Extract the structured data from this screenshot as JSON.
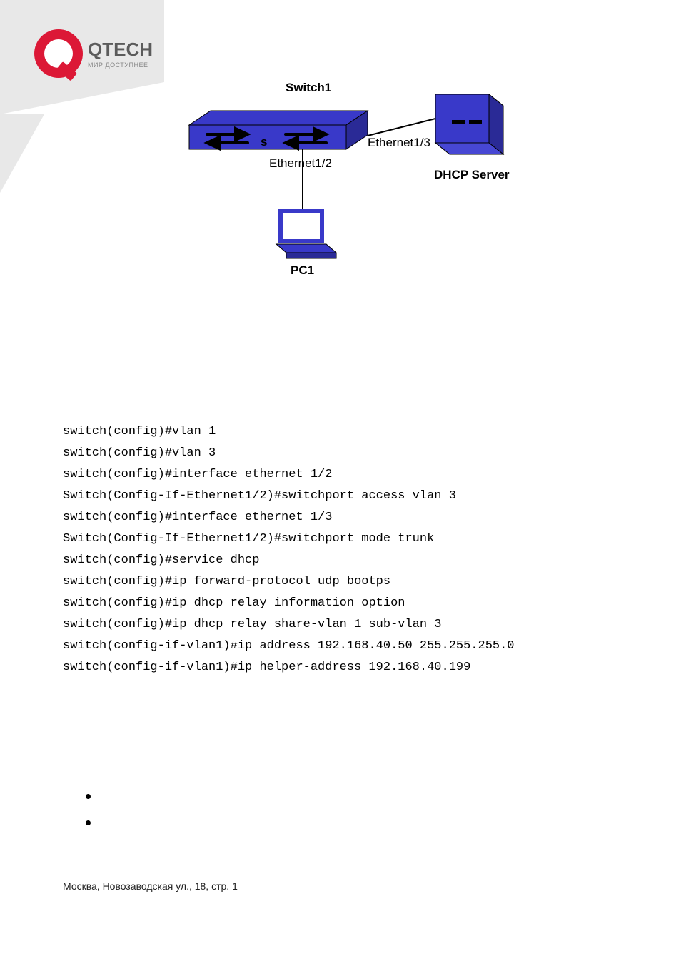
{
  "logo": {
    "brand": "QTECH",
    "tagline": "МИР ДОСТУПНЕЕ"
  },
  "diagram": {
    "switch_label": "Switch1",
    "port_left": "Ethernet1/2",
    "port_right": "Ethernet1/3",
    "pc_label": "PC1",
    "server_label": "DHCP Server",
    "switch_letter": "s"
  },
  "code": {
    "line1": "switch(config)#vlan 1",
    "line2": "switch(config)#vlan 3",
    "line3": "switch(config)#interface ethernet 1/2",
    "line4": "Switch(Config-If-Ethernet1/2)#switchport access vlan 3",
    "line5": "switch(config)#interface ethernet 1/3",
    "line6": "Switch(Config-If-Ethernet1/2)#switchport mode trunk",
    "line7": "switch(config)#service dhcp",
    "line8": "switch(config)#ip forward-protocol udp bootps",
    "line9": "switch(config)#ip dhcp relay information option",
    "line10": "switch(config)#ip dhcp relay share-vlan 1 sub-vlan 3",
    "line11": "switch(config-if-vlan1)#ip address 192.168.40.50 255.255.255.0",
    "line12": "switch(config-if-vlan1)#ip helper-address 192.168.40.199"
  },
  "footer": {
    "text": "Москва, Новозаводская ул., 18, стр. 1"
  }
}
